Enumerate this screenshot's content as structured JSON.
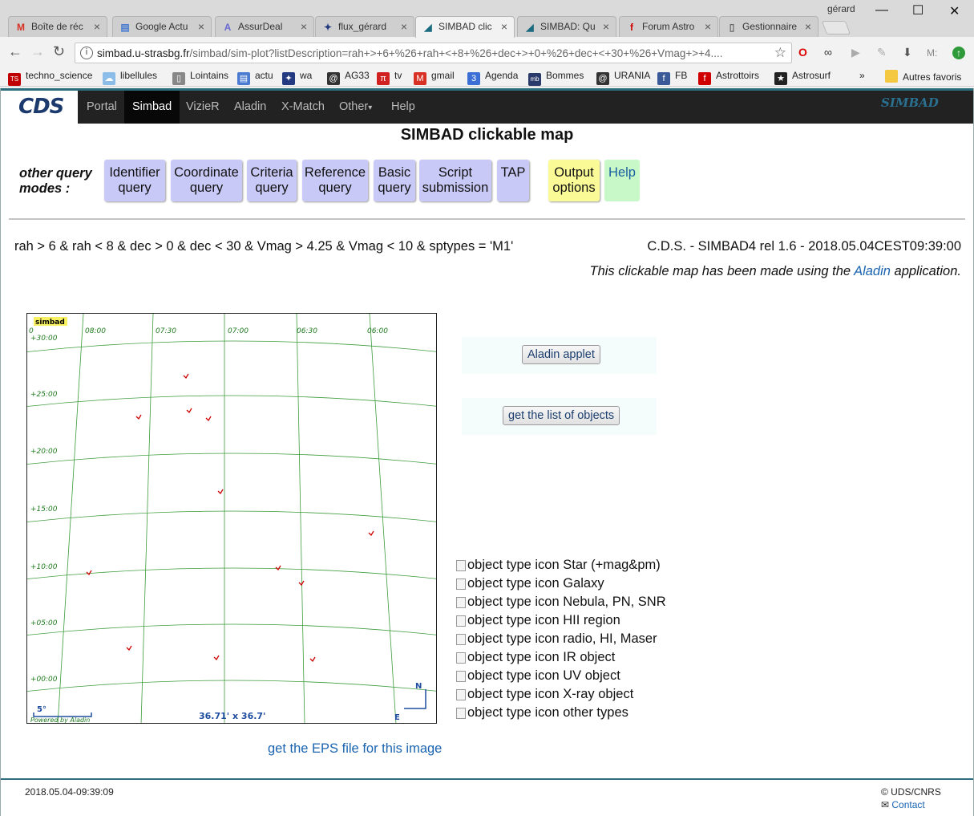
{
  "browser": {
    "tabs": [
      {
        "title": "Boîte de réc",
        "icon": "gmail-icon",
        "glyph": "M",
        "color": "#d93025"
      },
      {
        "title": "Google Actu",
        "icon": "google-news-icon",
        "glyph": "▤",
        "color": "#4a7bd0"
      },
      {
        "title": "AssurDeal",
        "icon": "assurdeal-icon",
        "glyph": "A",
        "color": "#6a6ad0"
      },
      {
        "title": "flux_gérard",
        "icon": "flux-icon",
        "glyph": "✦",
        "color": "#233a80"
      },
      {
        "title": "SIMBAD clic",
        "icon": "simbad-tab-icon",
        "glyph": "◢",
        "color": "#1a6a80"
      },
      {
        "title": "SIMBAD: Qu",
        "icon": "simbad-tab-icon",
        "glyph": "◢",
        "color": "#1a6a80"
      },
      {
        "title": "Forum Astro",
        "icon": "forum-icon",
        "glyph": "f",
        "color": "#d00000"
      },
      {
        "title": "Gestionnaire",
        "icon": "document-icon",
        "glyph": "▯",
        "color": "#666666"
      }
    ],
    "user": "gérard",
    "url_main": "simbad.u-strasbg.fr",
    "url_rest": "/simbad/sim-plot?listDescription=rah+>+6+%26+rah+<+8+%26+dec+>+0+%26+dec+<+30+%26+Vmag+>+4....",
    "bookmarks": [
      {
        "label": "techno_science",
        "icon": "techno-science-icon",
        "glyph": "TS",
        "color": "#c00000"
      },
      {
        "label": "libellules",
        "icon": "cloud-icon",
        "glyph": "☁",
        "color": "#8bbde8"
      },
      {
        "label": "Lointains",
        "icon": "document-icon",
        "glyph": "▯",
        "color": "#888888"
      },
      {
        "label": "actu",
        "icon": "news-icon",
        "glyph": "▤",
        "color": "#4a7bd0"
      },
      {
        "label": "wa",
        "icon": "flux-icon",
        "glyph": "✦",
        "color": "#233a80"
      },
      {
        "label": "AG33",
        "icon": "spiral-icon",
        "glyph": "@",
        "color": "#333333"
      },
      {
        "label": "tv",
        "icon": "tv-icon",
        "glyph": "π",
        "color": "#d02020"
      },
      {
        "label": "gmail",
        "icon": "gmail-icon",
        "glyph": "M",
        "color": "#d93025"
      },
      {
        "label": "Agenda",
        "icon": "calendar-icon",
        "glyph": "3",
        "color": "#3b6fd6"
      },
      {
        "label": "Bommes",
        "icon": "mb-icon",
        "glyph": "mb",
        "color": "#2a3a6a"
      },
      {
        "label": "URANIA",
        "icon": "spiral-icon",
        "glyph": "@",
        "color": "#333333"
      },
      {
        "label": "FB",
        "icon": "facebook-icon",
        "glyph": "f",
        "color": "#3b5998"
      },
      {
        "label": "Astrottoirs",
        "icon": "forum-icon",
        "glyph": "f",
        "color": "#d00000"
      },
      {
        "label": "Astrosurf",
        "icon": "astrosurf-icon",
        "glyph": "★",
        "color": "#222222"
      }
    ],
    "bookmarks_more": "»",
    "other_bookmarks": "Autres favoris"
  },
  "site": {
    "logo": "CDS",
    "nav": [
      "Portal",
      "Simbad",
      "VizieR",
      "Aladin",
      "X-Match",
      "Other",
      "Help"
    ],
    "active_nav": "Simbad",
    "simbad_logo": "SIMBAD"
  },
  "page": {
    "title": "SIMBAD clickable map",
    "other_modes_label_1": "other query",
    "other_modes_label_2": "modes :",
    "query_buttons": [
      {
        "l1": "Identifier",
        "l2": "query"
      },
      {
        "l1": "Coordinate",
        "l2": "query"
      },
      {
        "l1": "Criteria",
        "l2": "query"
      },
      {
        "l1": "Reference",
        "l2": "query"
      },
      {
        "l1": "Basic",
        "l2": "query"
      },
      {
        "l1": "Script",
        "l2": "submission"
      },
      {
        "l1": "TAP",
        "l2": ""
      }
    ],
    "output_options": {
      "l1": "Output",
      "l2": "options"
    },
    "help": "Help",
    "criteria": "rah > 6 & rah < 8 & dec > 0 & dec < 30 & Vmag > 4.25 & Vmag < 10 & sptypes = 'M1'",
    "release": "C.D.S. - SIMBAD4 rel 1.6 - 2018.05.04CEST09:39:00",
    "made_with_pre": "This clickable map has been made using the ",
    "made_with_link": "Aladin",
    "made_with_post": " application.",
    "aladin_applet": "Aladin applet",
    "get_list": "get the list of objects",
    "eps_link": "get the EPS file for this image",
    "legend": [
      "object type icon Star (+mag&pm)",
      "object type icon Galaxy",
      "object type icon Nebula, PN, SNR",
      "object type icon HII region",
      "object type icon radio, HI, Maser",
      "object type icon IR object",
      "object type icon UV object",
      "object type icon X-ray object",
      "object type icon other types"
    ]
  },
  "map": {
    "corner_label": "simbad",
    "ra_labels": [
      "0",
      "08:00",
      "07:30",
      "07:00",
      "06:30",
      "06:00"
    ],
    "dec_labels": [
      "+30:00",
      "+25:00",
      "+20:00",
      "+15:00",
      "+10:00",
      "+05:00",
      "+00:00"
    ],
    "scale_label": "5°",
    "fov_label": "36.71' x 36.7'",
    "credit": "Powered by Aladin",
    "north": "N",
    "east": "E",
    "grid_color": "#3c9c3c",
    "label_color": "#1e7a1e",
    "star_color": "#cc0000"
  },
  "footer": {
    "date": "2018.05.04-09:39:09",
    "copyright": "© UDS/CNRS",
    "contact": "Contact"
  }
}
